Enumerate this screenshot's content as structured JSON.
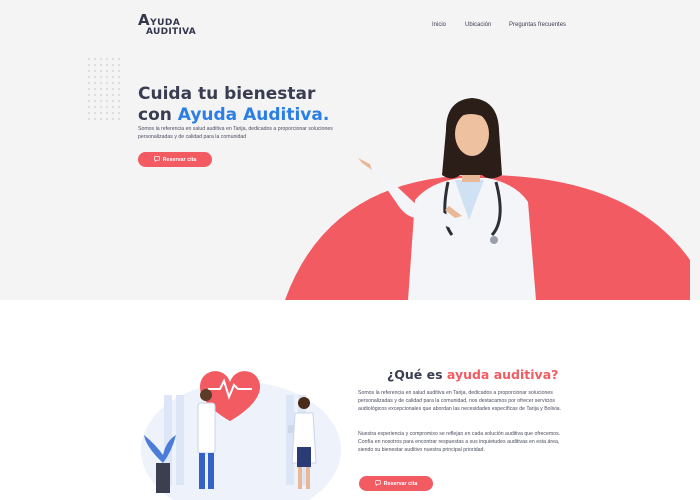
{
  "brand": {
    "line1_big": "A",
    "line1_rest": "YUDA",
    "line2": "AUDITIVA"
  },
  "nav": {
    "items": [
      "Inicio",
      "Ubicación",
      "Preguntas frecuentes"
    ]
  },
  "hero": {
    "title_line1": "Cuida tu bienestar",
    "title_line2_prefix": "con ",
    "title_line2_accent": "Ayuda Auditiva.",
    "description": "Somos la referencia en salud auditiva en Tarija, dedicados a proporcionar soluciones personalizadas y de calidad para la comunidad",
    "cta_label": "Reservar cita"
  },
  "about": {
    "title_prefix": "¿Qué es ",
    "title_accent": "ayuda auditiva?",
    "paragraph1": "Somos la referencia en salud auditiva en Tarija, dedicados a proporcionar soluciones personalizadas y de calidad para la comunidad, nos destacamos por ofrecer servicios audiológicos excepcionales que abordan las necesidades específicas de Tarija y Bolivia.",
    "paragraph2": "Nuestra experiencia y compromiso se reflejan en cada solución auditiva que ofrecemos. Confía en nosotros para encontrar respuestas a sus inquietudes auditivas en esta área, siendo su bienestar auditivo nuestra principal prioridad.",
    "cta_label": "Reservar cita"
  },
  "colors": {
    "accent_blue": "#2a7ee6",
    "accent_coral": "#f25b62",
    "text_dark": "#3a3d52",
    "hero_bg": "#f4f4f5"
  },
  "icons": {
    "cta_icon": "chat-bubble-icon"
  }
}
